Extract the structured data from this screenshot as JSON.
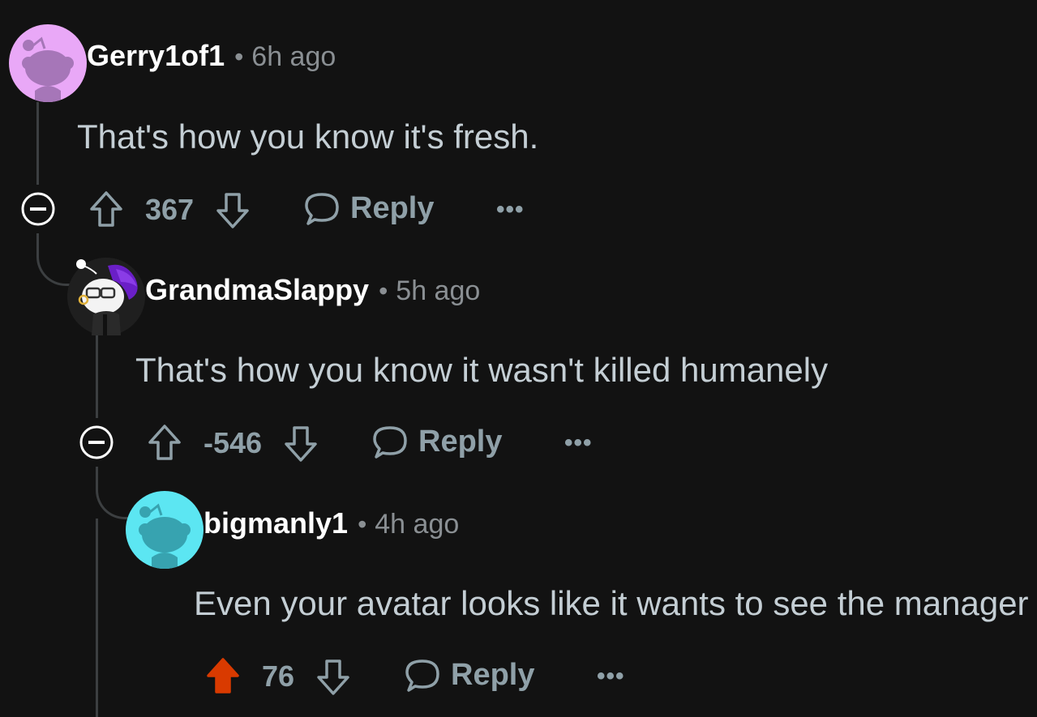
{
  "comments": [
    {
      "username": "Gerry1of1",
      "time": "6h ago",
      "separator": "•",
      "body": "That's how you know it's fresh.",
      "score": "367",
      "upvoted": false,
      "reply_label": "Reply",
      "more_label": "•••",
      "avatar_bg": "#e9a8f7",
      "avatar_fg": "#a676b8"
    },
    {
      "username": "GrandmaSlappy",
      "time": "5h ago",
      "separator": "•",
      "body": "That's how you know it wasn't killed humanely",
      "score": "-546",
      "upvoted": false,
      "reply_label": "Reply",
      "more_label": "•••",
      "avatar_bg": "#1a1a1a",
      "avatar_fg": "#6a1fc7"
    },
    {
      "username": "bigmanly1",
      "time": "4h ago",
      "separator": "•",
      "body": "Even your avatar looks like it wants to see the manager",
      "score": "76",
      "upvoted": true,
      "reply_label": "Reply",
      "more_label": "•••",
      "avatar_bg": "#5ce6f2",
      "avatar_fg": "#37a3b0"
    }
  ],
  "colors": {
    "background": "#121212",
    "upvote_active": "#d93a00",
    "muted": "#8fa0a8"
  }
}
